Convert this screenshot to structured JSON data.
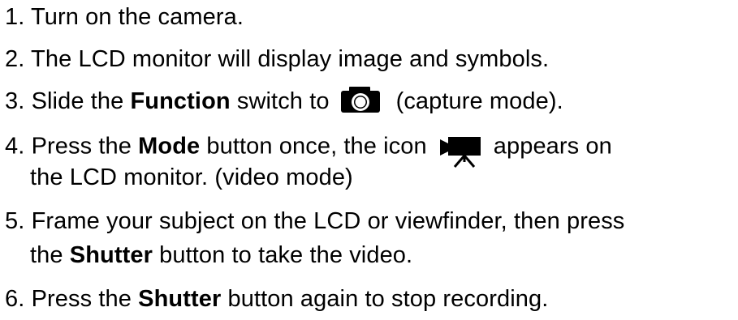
{
  "steps": [
    {
      "num": "1.",
      "text": "Turn on the camera."
    },
    {
      "num": "2.",
      "text": "The LCD monitor will display image and symbols."
    },
    {
      "num": "3.",
      "pre": "Slide the ",
      "bold": "Function",
      "mid": " switch to",
      "post": "(capture mode)."
    },
    {
      "num": "4.",
      "pre": "Press the ",
      "bold": "Mode",
      "mid": " button once, the icon",
      "post": "appears on",
      "cont": "the LCD monitor. (video mode)"
    },
    {
      "num": "5.",
      "text": "Frame your subject on the LCD or viewfinder, then press",
      "cont_bold": "Shutter",
      "cont_pre": "the ",
      "cont_post": " button to take the video."
    },
    {
      "num": "6.",
      "pre": "Press the ",
      "bold": "Shutter",
      "post": " button again to stop recording."
    }
  ],
  "icons": {
    "capture": "camera-icon",
    "video": "video-camera-icon"
  },
  "colors": {
    "text": "#000000",
    "background": "#ffffff"
  }
}
